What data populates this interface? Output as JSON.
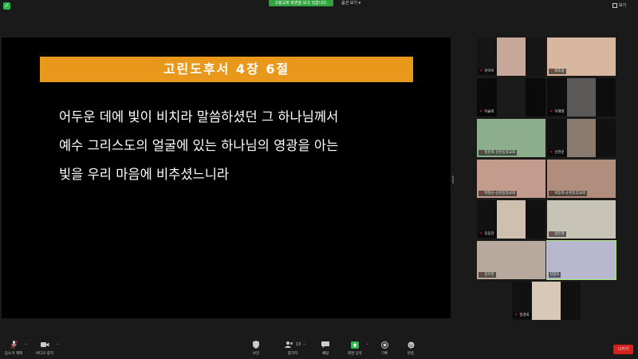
{
  "topbar": {
    "notice": "고림교회 화면을 보고 있습니다.",
    "view_options": "옵션 보기 ▾",
    "gallery_toggle": "보기"
  },
  "share": {
    "title": "고린도후서 4장 6절",
    "verse_lines": [
      "어두운 데에 빛이 비치라 말씀하셨던 그 하나님께서",
      "예수 그리스도의 얼굴에 있는 하나님의 영광을 아는",
      "빛을 우리 마음에 비추셨느니라"
    ],
    "banner_color": "#e8981a"
  },
  "participants": [
    {
      "name": "유아이",
      "bg": "#151515",
      "vid": "#c7a89a",
      "wide": false
    },
    {
      "name": "박호중",
      "bg": "#a56a55",
      "vid": "#d8b7a0",
      "wide": true
    },
    {
      "name": "이슬희",
      "bg": "#0a0a0a",
      "vid": "#1a1a1a",
      "wide": false
    },
    {
      "name": "이해영",
      "bg": "#0d0d0d",
      "vid": "#5c5a58",
      "wide": false
    },
    {
      "name": "정운희-순천동일교회",
      "bg": "#6d9bc3",
      "vid": "#8cae8c",
      "wide": true
    },
    {
      "name": "신현운",
      "bg": "#111111",
      "vid": "#8b7b6f",
      "wide": false
    },
    {
      "name": "박정순-순천동일교회",
      "bg": "#8b6f6a",
      "vid": "#c49c8e",
      "wide": true
    },
    {
      "name": "박동희-순천동일교회",
      "bg": "#7a6c6a",
      "vid": "#b08d7c",
      "wide": true
    },
    {
      "name": "김동찬",
      "bg": "#111111",
      "vid": "#cfbfae",
      "wide": false
    },
    {
      "name": "김은영",
      "bg": "#9aa9b6",
      "vid": "#c7c3b5",
      "wide": true
    },
    {
      "name": "김우진",
      "bg": "#8f8b7c",
      "vid": "#b8a99d",
      "wide": true
    },
    {
      "name": "김정호",
      "bg": "#a9a5c2",
      "vid": "#b9b6cf",
      "wide": true
    },
    {
      "name": "정경희",
      "bg": "#111111",
      "vid": "#d8c8b8",
      "wide": false
    }
  ],
  "toolbar": {
    "mute": "음소거 해제",
    "video": "비디오 중지",
    "security": "보안",
    "participants": "참가자",
    "participant_count": "13",
    "chat": "채팅",
    "share": "화면 공유",
    "record": "기록",
    "reactions": "반응",
    "leave": "나가기",
    "share_color": "#2fb84f",
    "leave_color": "#d7211c"
  }
}
